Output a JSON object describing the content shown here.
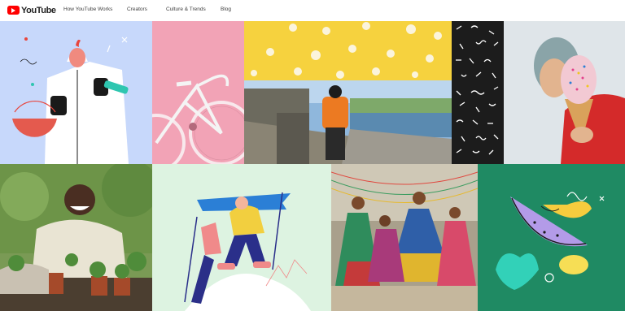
{
  "header": {
    "brand": "YouTube",
    "nav": [
      {
        "label": "How YouTube Works"
      },
      {
        "label": "Creators"
      },
      {
        "label": "Culture & Trends"
      },
      {
        "label": "Blog"
      }
    ]
  },
  "colors": {
    "brand_red": "#ff0000",
    "tile_scientist_bg": "#c7d8fb",
    "tile_bike_bg": "#f2a3b6",
    "tile_popcorn_bg": "#f6d23e",
    "tile_pattern_bg": "#1c1c1c",
    "tile_climb_bg": "#ddf3e1",
    "tile_fruit_bg": "#1f8a63"
  },
  "gallery": [
    {
      "icon": "scientist-illustration"
    },
    {
      "icon": "pink-bicycle-photo"
    },
    {
      "icon": "popcorn-photo"
    },
    {
      "icon": "motorcycle-rider-photo"
    },
    {
      "icon": "squiggle-pattern"
    },
    {
      "icon": "ice-cream-photo"
    },
    {
      "icon": "gardener-photo"
    },
    {
      "icon": "mountain-climbers-illustration"
    },
    {
      "icon": "dancers-photo"
    },
    {
      "icon": "fruit-illustration"
    }
  ]
}
